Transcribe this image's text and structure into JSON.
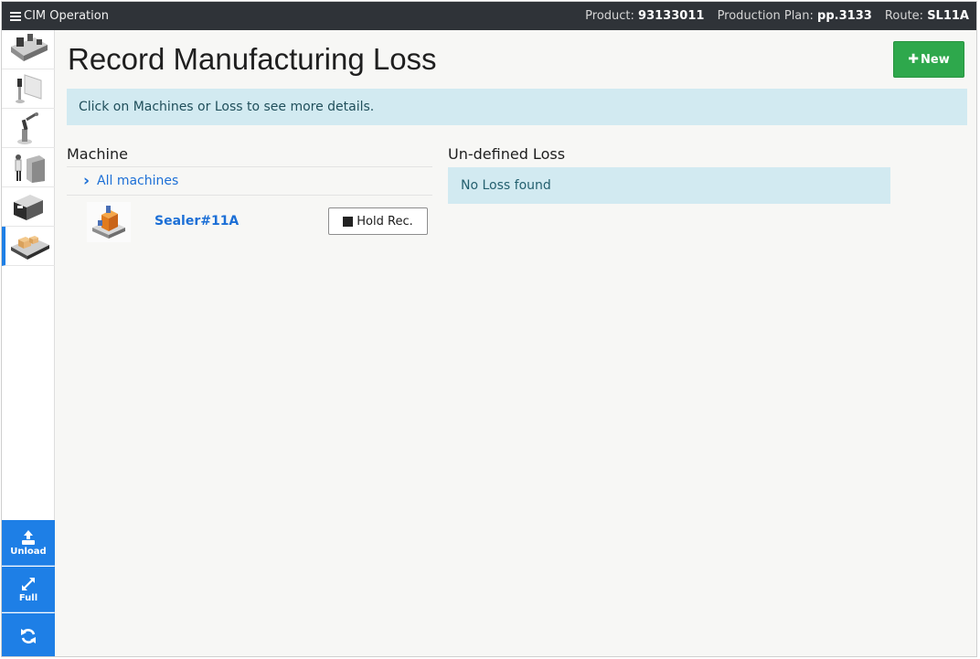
{
  "topbar": {
    "app_title": "CIM Operation",
    "product_label": "Product:",
    "product_value": "93133011",
    "plan_label": "Production Plan:",
    "plan_value": "pp.3133",
    "route_label": "Route:",
    "route_value": "SL11A",
    "background": "#2f3338"
  },
  "rail": {
    "items": [
      {
        "icon": "conveyor-line-thumbnail",
        "active": false
      },
      {
        "icon": "robot-arm-screen-thumbnail",
        "active": false
      },
      {
        "icon": "robot-arm-thumbnail",
        "active": false
      },
      {
        "icon": "operator-cabinet-thumbnail",
        "active": false
      },
      {
        "icon": "printer-machine-thumbnail",
        "active": false
      },
      {
        "icon": "conveyor-boxes-thumbnail",
        "active": true
      }
    ],
    "buttons": {
      "unload_label": "Unload",
      "full_label": "Full",
      "refresh_icon": "refresh-icon"
    },
    "accent": "#1e7fe6"
  },
  "page": {
    "title": "Record Manufacturing Loss",
    "new_button_label": "New",
    "new_button_color": "#2ea84c",
    "banner_text": "Click on Machines or Loss to see more details."
  },
  "machine_section": {
    "heading": "Machine",
    "all_machines_label": "All machines",
    "machines": [
      {
        "name": "Sealer#11A",
        "hold_label": "Hold Rec."
      }
    ]
  },
  "loss_section": {
    "heading": "Un-defined Loss",
    "empty_text": "No Loss found"
  }
}
